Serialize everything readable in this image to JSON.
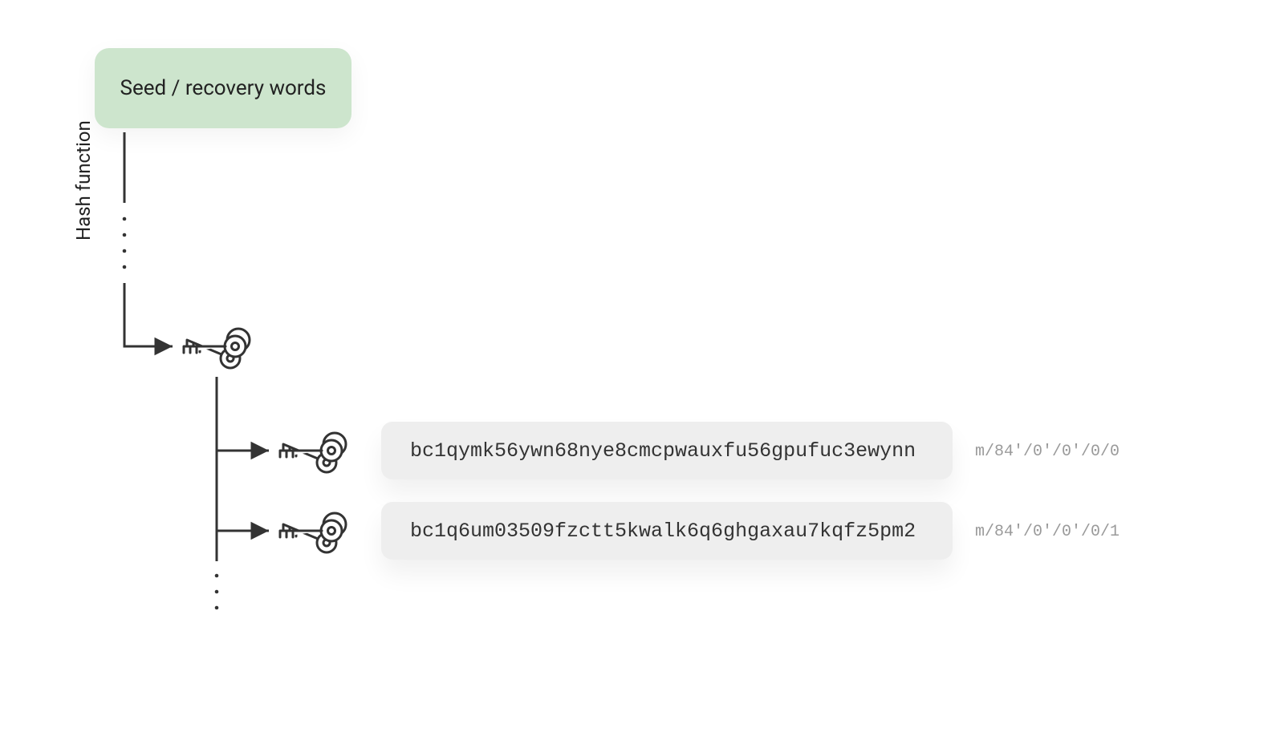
{
  "seed_label": "Seed / recovery words",
  "hash_label": "Hash function",
  "addresses": [
    {
      "address": "bc1qymk56ywn68nye8cmcpwauxfu56gpufuc3ewynn",
      "path": "m/84'/0'/0'/0/0"
    },
    {
      "address": "bc1q6um03509fzctt5kwalk6q6ghgaxau7kqfz5pm2",
      "path": "m/84'/0'/0'/0/1"
    }
  ]
}
